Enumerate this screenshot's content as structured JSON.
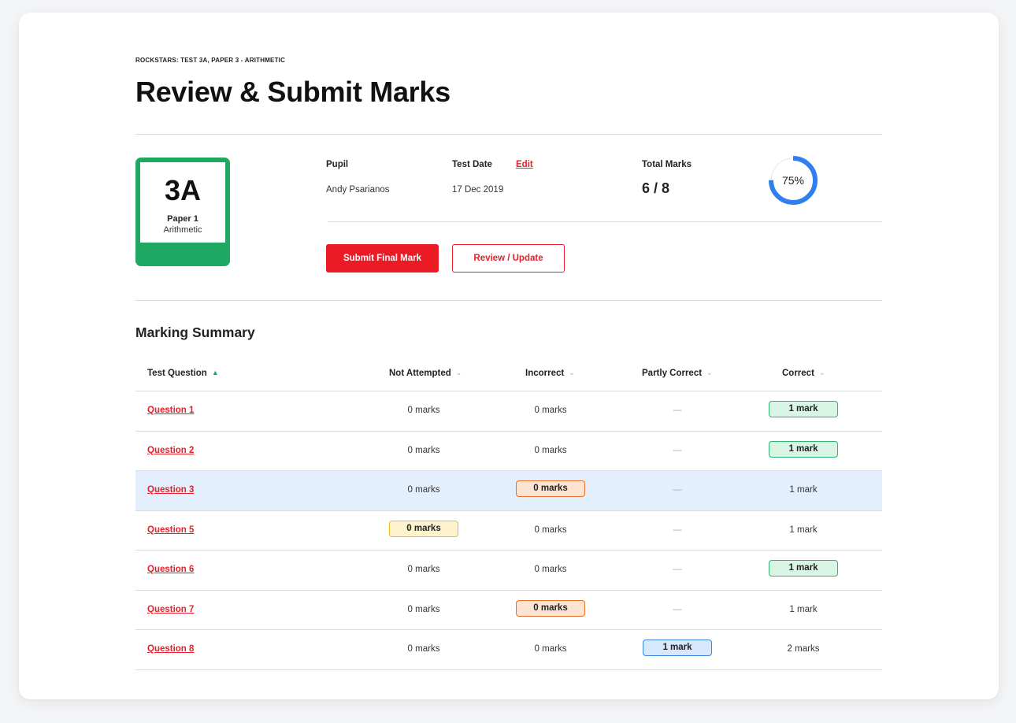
{
  "breadcrumb": "ROCKSTARS: TEST 3A, PAPER 3 - ARITHMETIC",
  "page_title": "Review & Submit Marks",
  "paper_tile": {
    "code": "3A",
    "paper": "Paper 1",
    "subject": "Arithmetic",
    "color": "#1fa863"
  },
  "pupil": {
    "label": "Pupil",
    "value": "Andy Psarianos"
  },
  "test_date": {
    "label": "Test Date",
    "edit": "Edit",
    "value": "17 Dec 2019"
  },
  "total_marks": {
    "label": "Total Marks",
    "value": "6 / 8"
  },
  "progress": {
    "percent": 75,
    "label": "75%",
    "color": "#2f7ff0"
  },
  "buttons": {
    "submit": "Submit Final Mark",
    "review": "Review / Update"
  },
  "section_title": "Marking Summary",
  "table": {
    "columns": {
      "question": "Test Question",
      "not_attempted": "Not Attempted",
      "incorrect": "Incorrect",
      "partly_correct": "Partly Correct",
      "correct": "Correct"
    },
    "sort_icons": {
      "question": "chevron-up-icon",
      "others": "chevron-down-icon"
    },
    "rows": [
      {
        "question": "Question 1",
        "not_attempted": "0 marks",
        "incorrect": "0 marks",
        "partly_correct": "—",
        "correct": "1 mark",
        "highlight": "correct",
        "highlight_color": "green"
      },
      {
        "question": "Question 2",
        "not_attempted": "0 marks",
        "incorrect": "0 marks",
        "partly_correct": "—",
        "correct": "1 mark",
        "highlight": "correct",
        "highlight_color": "green"
      },
      {
        "question": "Question 3",
        "not_attempted": "0 marks",
        "incorrect": "0 marks",
        "partly_correct": "—",
        "correct": "1 mark",
        "highlight": "incorrect",
        "highlight_color": "orange",
        "selected": true
      },
      {
        "question": "Question 5",
        "not_attempted": "0 marks",
        "incorrect": "0 marks",
        "partly_correct": "—",
        "correct": "1 mark",
        "highlight": "not_attempted",
        "highlight_color": "yellow"
      },
      {
        "question": "Question 6",
        "not_attempted": "0 marks",
        "incorrect": "0 marks",
        "partly_correct": "—",
        "correct": "1 mark",
        "highlight": "correct",
        "highlight_color": "green"
      },
      {
        "question": "Question 7",
        "not_attempted": "0 marks",
        "incorrect": "0 marks",
        "partly_correct": "—",
        "correct": "1 mark",
        "highlight": "incorrect",
        "highlight_color": "orange"
      },
      {
        "question": "Question 8",
        "not_attempted": "0 marks",
        "incorrect": "0 marks",
        "partly_correct": "1 mark",
        "correct": "2 marks",
        "highlight": "partly_correct",
        "highlight_color": "blue"
      }
    ]
  }
}
